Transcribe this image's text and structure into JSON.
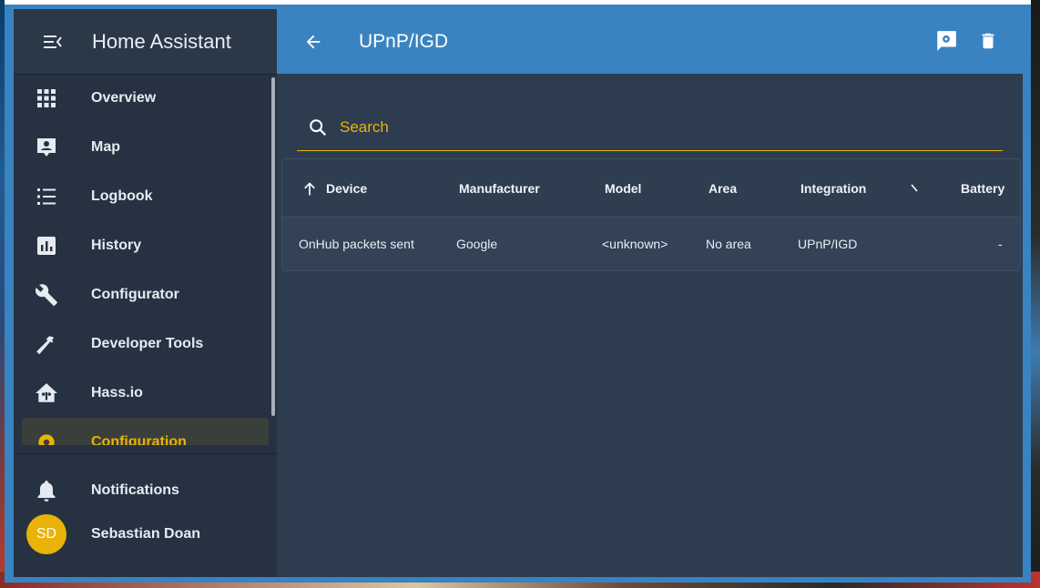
{
  "app": {
    "title": "Home Assistant"
  },
  "sidebar": {
    "items": [
      {
        "label": "Overview",
        "icon": "grid-icon"
      },
      {
        "label": "Map",
        "icon": "map-icon"
      },
      {
        "label": "Logbook",
        "icon": "list-icon"
      },
      {
        "label": "History",
        "icon": "chart-icon"
      },
      {
        "label": "Configurator",
        "icon": "wrench-icon"
      },
      {
        "label": "Developer Tools",
        "icon": "hammer-icon"
      },
      {
        "label": "Hass.io",
        "icon": "hassio-icon"
      },
      {
        "label": "Configuration",
        "icon": "gear-icon",
        "active": true
      }
    ],
    "notifications_label": "Notifications",
    "user": {
      "name": "Sebastian Doan",
      "initials": "SD"
    }
  },
  "header": {
    "title": "UPnP/IGD"
  },
  "search": {
    "placeholder": "Search"
  },
  "table": {
    "columns": [
      "Device",
      "Manufacturer",
      "Model",
      "Area",
      "Integration",
      "Battery"
    ],
    "rows": [
      {
        "device": "OnHub packets sent",
        "manufacturer": "Google",
        "model": "<unknown>",
        "area": "No area",
        "integration": "UPnP/IGD",
        "battery": "-"
      }
    ]
  },
  "colors": {
    "accent": "#e9b307",
    "header": "#3a83c1",
    "sidebar": "#263241",
    "main": "#2e3c4f"
  }
}
